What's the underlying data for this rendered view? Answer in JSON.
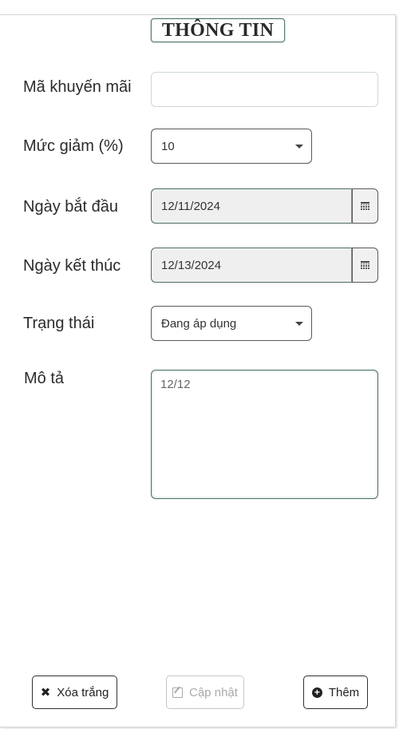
{
  "header": {
    "title": "THÔNG TIN"
  },
  "fields": {
    "promo_code": {
      "label": "Mã khuyến mãi",
      "value": ""
    },
    "discount": {
      "label": "Mức giảm (%)",
      "value": "10"
    },
    "start_date": {
      "label": "Ngày bắt đầu",
      "value": "12/11/2024"
    },
    "end_date": {
      "label": "Ngày kết thúc",
      "value": "12/13/2024"
    },
    "status": {
      "label": "Trạng thái",
      "value": "Đang áp dụng"
    },
    "description": {
      "label": "Mô tả",
      "value": "12/12"
    }
  },
  "actions": {
    "clear_label": "Xóa trắng",
    "update_label": "Cập nhật",
    "add_label": "Thêm"
  },
  "icons": {
    "clear": "close-icon",
    "update": "edit-icon",
    "add": "plus-circle-icon",
    "calendar": "calendar-icon",
    "dropdown": "caret-down-icon"
  }
}
